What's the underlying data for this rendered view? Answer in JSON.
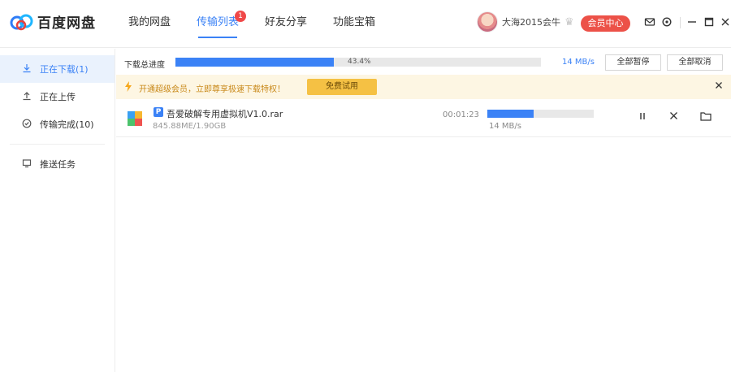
{
  "app": {
    "logo_text": "百度网盘"
  },
  "nav": [
    {
      "label": "我的网盘"
    },
    {
      "label": "传输列表",
      "badge": "1"
    },
    {
      "label": "好友分享"
    },
    {
      "label": "功能宝箱"
    }
  ],
  "user": {
    "name": "大海2015会牛",
    "vip_button": "会员中心"
  },
  "sidebar": {
    "items": [
      {
        "label": "正在下载(1)",
        "icon": "download-icon"
      },
      {
        "label": "正在上传",
        "icon": "upload-icon"
      },
      {
        "label": "传输完成(10)",
        "icon": "check-circle-icon"
      },
      {
        "label": "推送任务",
        "icon": "monitor-icon"
      }
    ]
  },
  "overall": {
    "label": "下载总进度",
    "percent_text": "43.4%",
    "percent": 43.4,
    "speed": "14 MB/s",
    "pause_all": "全部暂停",
    "cancel_all": "全部取消"
  },
  "promo": {
    "text": "开通超级会员，立即尊享极速下载特权！",
    "button": "免费试用"
  },
  "downloads": [
    {
      "name": "吾爱破解专用虚拟机V1.0.rar",
      "size": "845.88ME/1.90GB",
      "time_left": "00:01:23",
      "speed": "14 MB/s",
      "progress": 43.4
    }
  ],
  "colors": {
    "accent": "#3b82f6",
    "vip": "#ec5148",
    "promo_bg": "#fdf6e3",
    "promo_btn": "#f5c144"
  }
}
